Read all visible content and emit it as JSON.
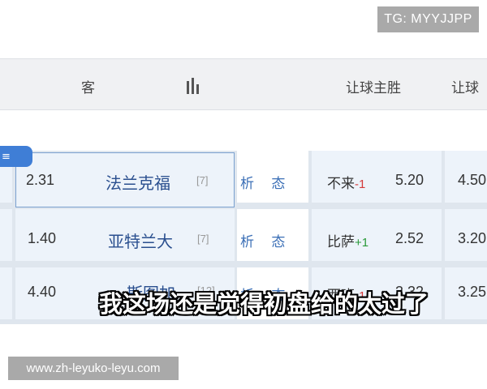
{
  "watermarks": {
    "top": "TG: MYYJJPP",
    "bottom": "www.zh-leyuko-leyu.com"
  },
  "header": {
    "away": "客",
    "home_win": "让球主胜",
    "next": "让球"
  },
  "tag_text": "≡",
  "rows": [
    {
      "odds": "2.31",
      "team": "法兰克福",
      "rank": "[7]",
      "analysis": "析 态",
      "hcap_team": "不来",
      "hcap_sign": "-1",
      "hcap_odds": "5.20",
      "next_odds": "4.50"
    },
    {
      "odds": "1.40",
      "team": "亚特兰大",
      "rank": "[7]",
      "analysis": "析 态",
      "hcap_team": "比萨",
      "hcap_sign": "+1",
      "hcap_odds": "2.52",
      "next_odds": "3.20"
    },
    {
      "odds": "4.40",
      "team": "斯图加",
      "rank": "[12]",
      "analysis": "析 态",
      "hcap_team": "西班",
      "hcap_sign": "-1",
      "hcap_odds": "3.32",
      "next_odds": "3.25"
    }
  ],
  "subtitle": "我这场还是觉得初盘给的太过了"
}
